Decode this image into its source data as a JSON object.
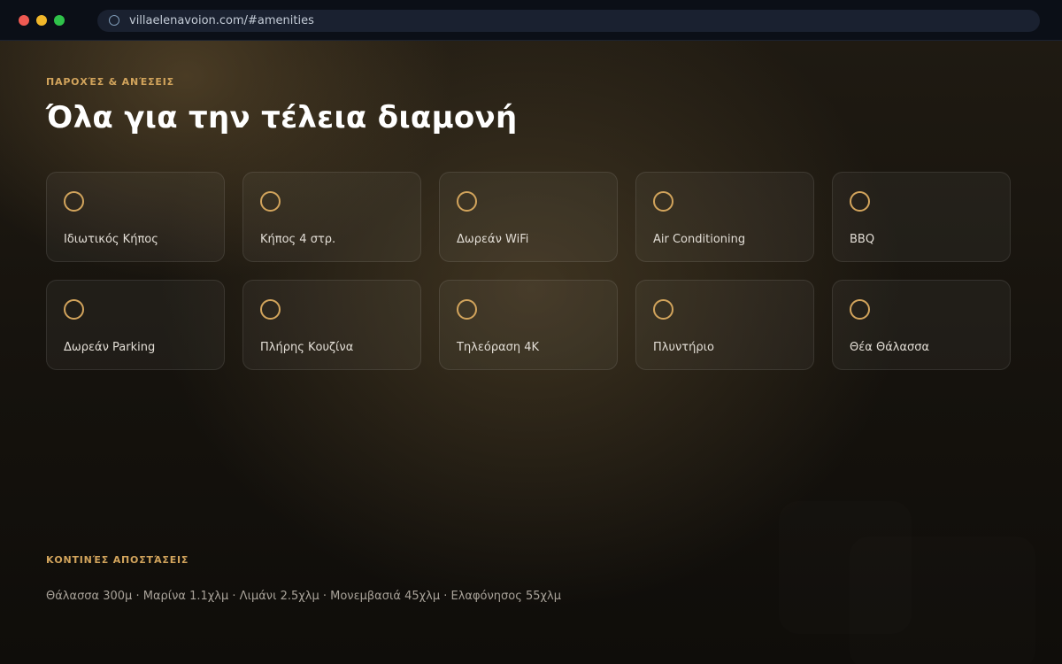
{
  "browser": {
    "url": "villaelenavoion.com/#amenities"
  },
  "amenities_section": {
    "eyebrow": "ΠΑΡΟΧΈΣ & ΑΝΈΣΕΙΣ",
    "title": "Όλα για την τέλεια διαμονή",
    "items": [
      {
        "label": "Ιδιωτικός Κήπος",
        "icon": "circle-icon"
      },
      {
        "label": "Κήπος 4 στρ.",
        "icon": "circle-icon"
      },
      {
        "label": "Δωρεάν WiFi",
        "icon": "circle-icon"
      },
      {
        "label": "Air Conditioning",
        "icon": "circle-icon"
      },
      {
        "label": "BBQ",
        "icon": "circle-icon"
      },
      {
        "label": "Δωρεάν Parking",
        "icon": "circle-icon"
      },
      {
        "label": "Πλήρης Κουζίνα",
        "icon": "circle-icon"
      },
      {
        "label": "Τηλεόραση 4K",
        "icon": "circle-icon"
      },
      {
        "label": "Πλυντήριο",
        "icon": "circle-icon"
      },
      {
        "label": "Θέα Θάλασσα",
        "icon": "circle-icon"
      }
    ]
  },
  "distances_section": {
    "eyebrow": "ΚΟΝΤΙΝΈΣ ΑΠΟΣΤΆΣΕΙΣ",
    "text": "Θάλασσα 300μ · Μαρίνα 1.1χλμ · Λιμάνι 2.5χλμ · Μονεμβασιά 45χλμ · Ελαφόνησος 55χλμ"
  },
  "colors": {
    "accent": "#d2a45c",
    "background": "#15120d",
    "title": "#ffffff"
  }
}
